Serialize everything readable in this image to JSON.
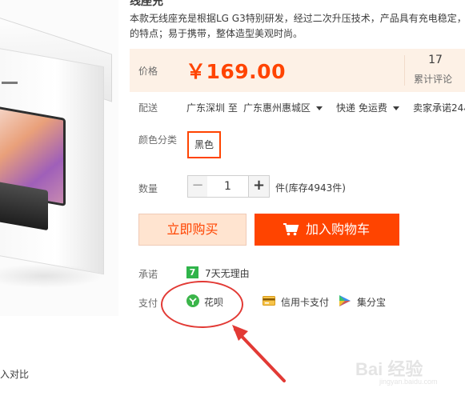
{
  "product": {
    "title": "线座充",
    "description_line1": "本款无线座充是根据LG G3特别研发，经过二次升压技术，产品具有充电稳定，",
    "description_line2": "的特点；易于携带，整体造型美观时尚。"
  },
  "price": {
    "label": "价格",
    "value": "￥169.00",
    "color": "#ff4400",
    "review_count": "17",
    "review_label": "累计评论"
  },
  "shipping": {
    "label": "配送",
    "origin": "广东深圳 至",
    "destination": "广东惠州惠城区",
    "delivery": "快递 免运费",
    "seller_promise": "卖家承诺24小"
  },
  "color": {
    "label": "颜色分类",
    "selected": "黑色"
  },
  "quantity": {
    "label": "数量",
    "minus": "−",
    "value": "1",
    "plus": "+",
    "stock": "件(库存4943件)"
  },
  "actions": {
    "buy_now": "立即购买",
    "add_to_cart": "加入购物车"
  },
  "promise": {
    "label": "承诺",
    "badge": "7",
    "text": "7天无理由"
  },
  "payment": {
    "label": "支付",
    "methods": [
      {
        "name": "花呗",
        "icon": "huabei-icon"
      },
      {
        "name": "信用卡支付",
        "icon": "credit-card-icon"
      },
      {
        "name": "集分宝",
        "icon": "jifenbao-icon"
      }
    ]
  },
  "left": {
    "compare_text": "入对比"
  },
  "watermark": {
    "logo": "Bai 经验",
    "url": "jingyan.baidu.com"
  }
}
